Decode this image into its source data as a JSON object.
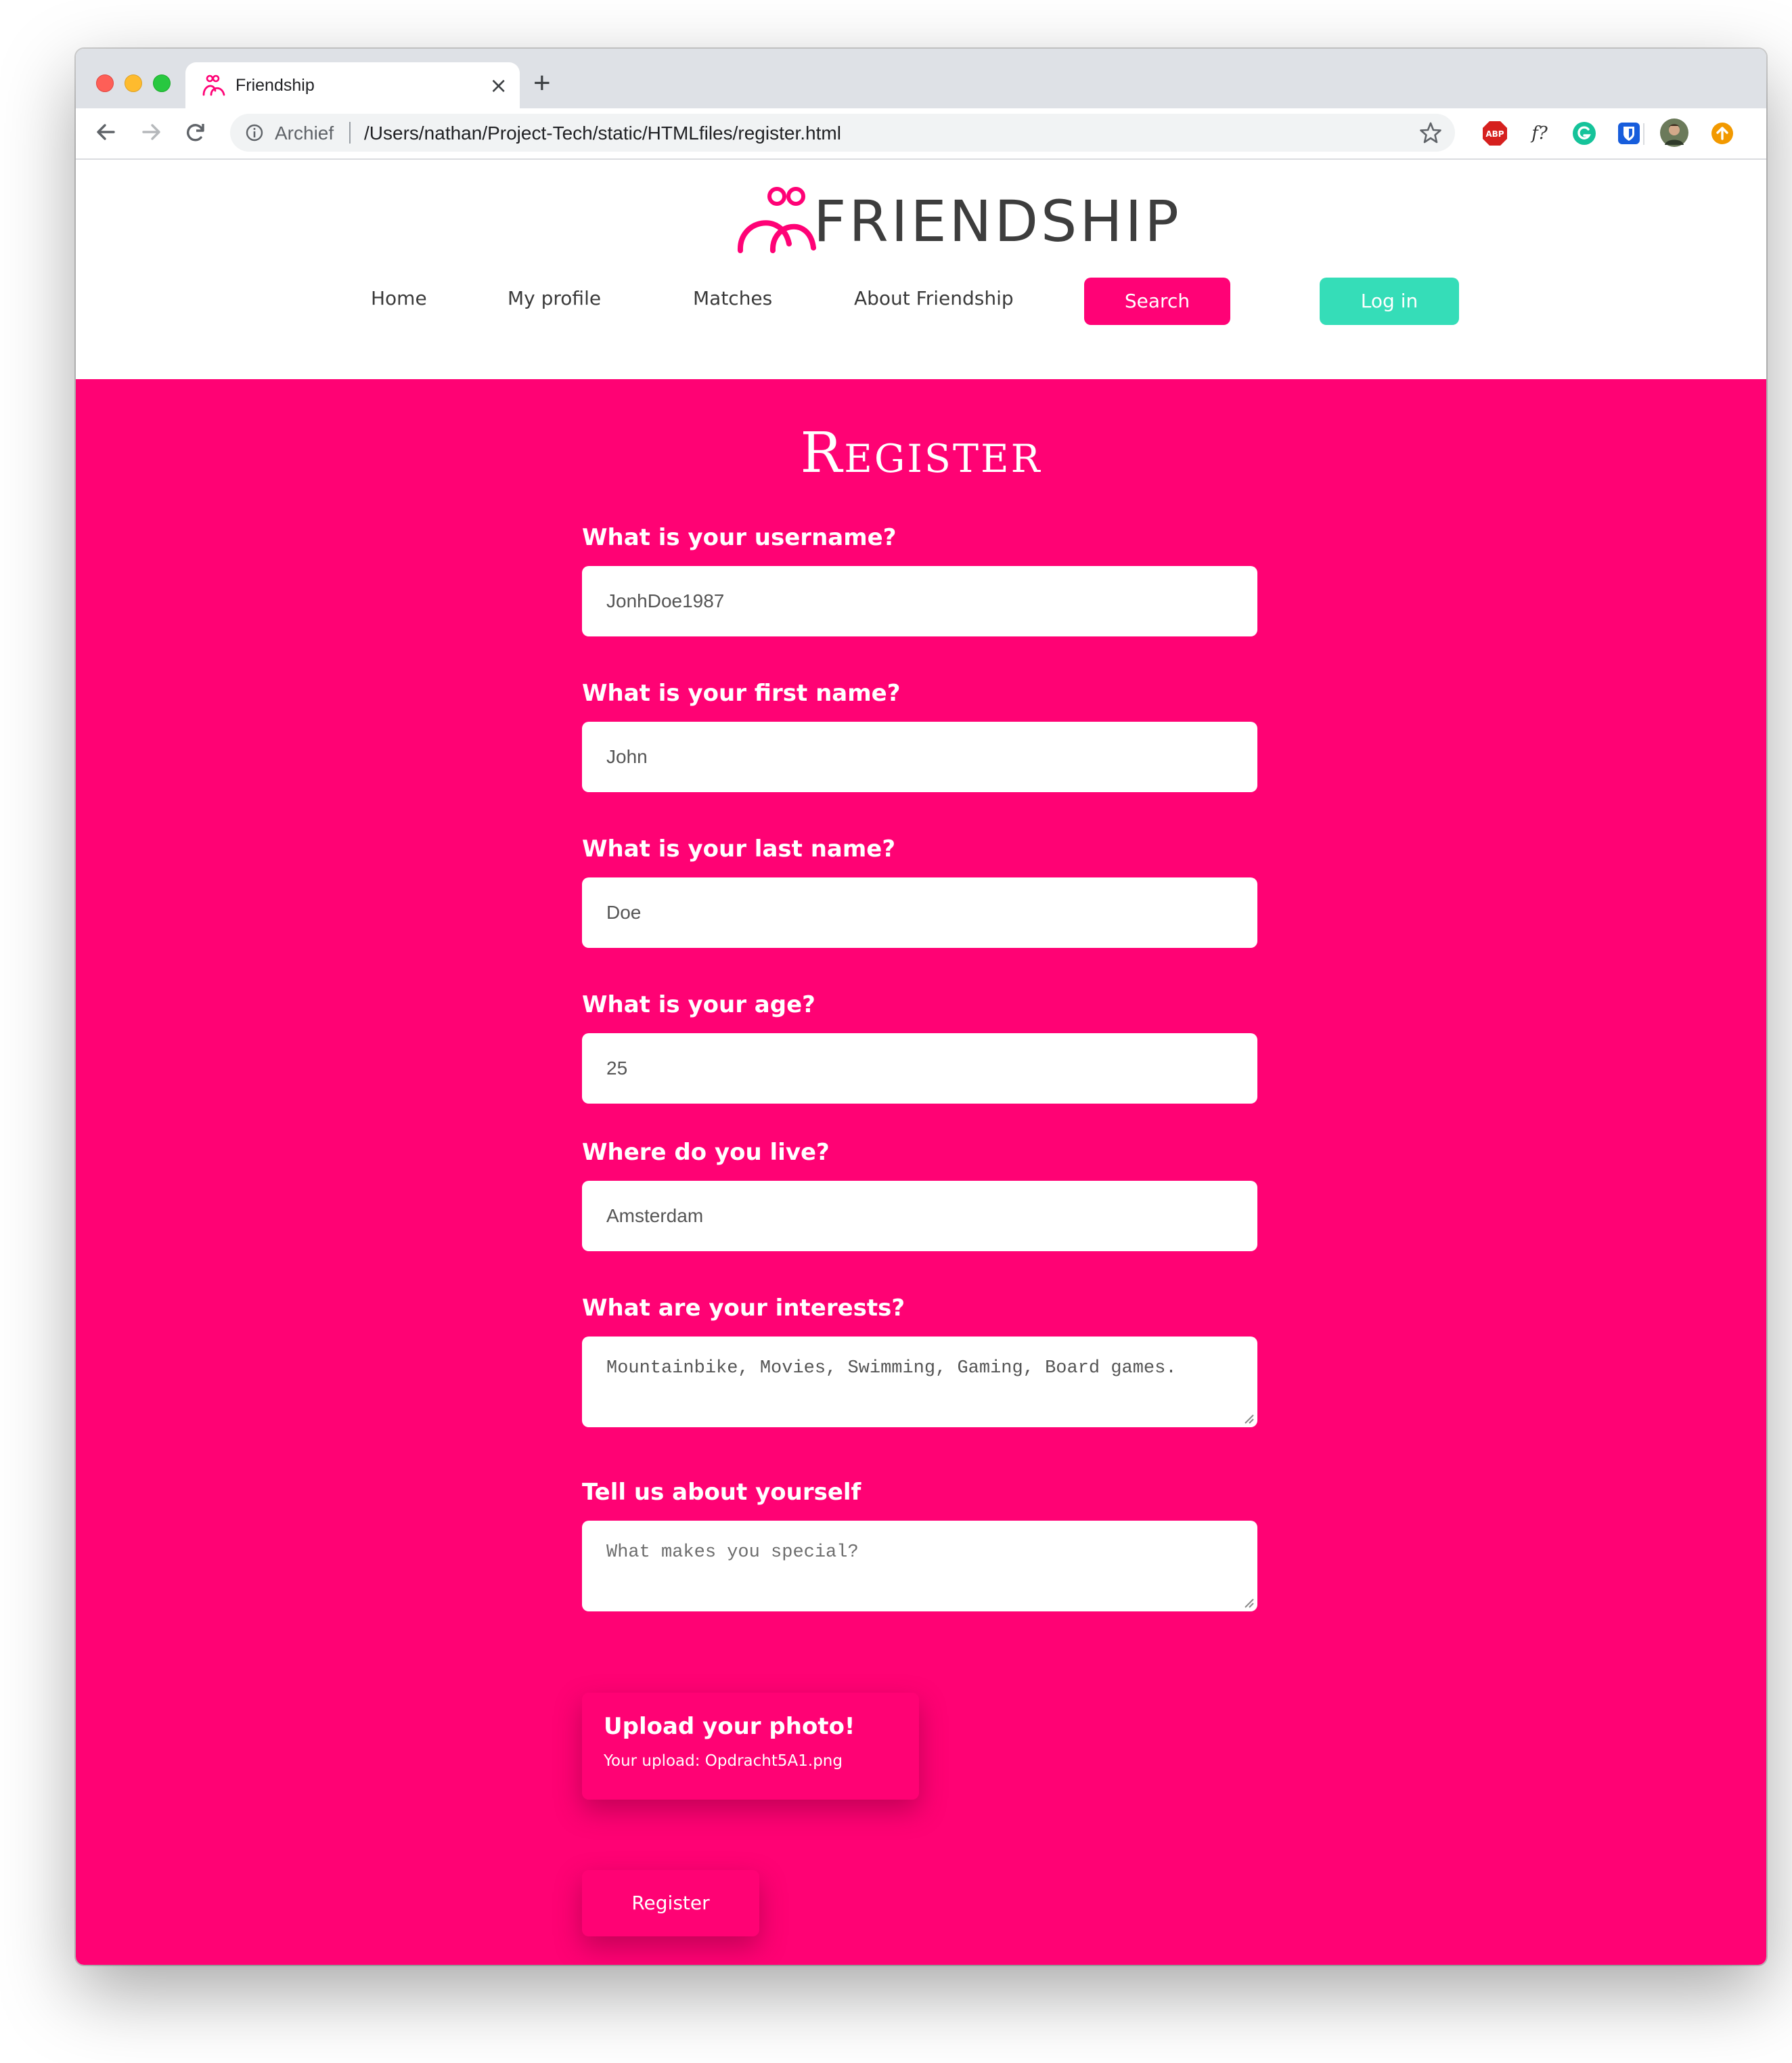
{
  "browser": {
    "tab_title": "Friendship",
    "tab_close": "×",
    "new_tab": "+",
    "omnibox_label": "Archief",
    "url": "/Users/nathan/Project-Tech/static/HTMLfiles/register.html",
    "extensions": [
      "adblock-plus-icon",
      "whatfont-icon",
      "grammarly-icon",
      "bitwarden-icon",
      "profile-avatar-icon",
      "update-icon"
    ],
    "extension_abp_text": "ABP",
    "extension_whatfont_text": "f?"
  },
  "site": {
    "brand": "Friendship",
    "logo_text": "FRIENDSHIP",
    "nav": {
      "home": "Home",
      "profile": "My profile",
      "matches": "Matches",
      "about": "About Friendship",
      "search": "Search",
      "login": "Log in"
    },
    "colors": {
      "brand_pink": "#ff0274",
      "accent_teal": "#35ddb8"
    }
  },
  "form": {
    "title": "Register",
    "username_label": "What is your username?",
    "username_value": "JonhDoe1987",
    "firstname_label": "What is your first name?",
    "firstname_value": "John",
    "lastname_label": "What is your last name?",
    "lastname_value": "Doe",
    "age_label": "What is your age?",
    "age_value": "25",
    "city_label": "Where do you live?",
    "city_value": "Amsterdam",
    "interests_label": "What are your interests?",
    "interests_value": "Mountainbike, Movies, Swimming, Gaming, Board games.",
    "about_label": "Tell us about yourself",
    "about_placeholder": "What makes you special?",
    "upload_title": "Upload your photo!",
    "upload_file": "Your upload: Opdracht5A1.png",
    "register_button": "Register"
  }
}
